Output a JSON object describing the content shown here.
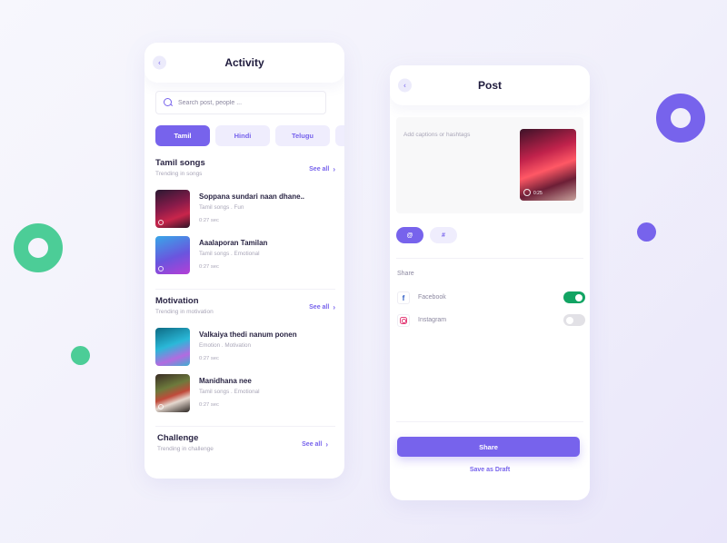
{
  "colors": {
    "accent": "#7763ec",
    "green": "#4ccd97",
    "toggle_on": "#12a463"
  },
  "activity": {
    "title": "Activity",
    "back_icon": "chevron-left-icon",
    "search": {
      "placeholder": "Search post, people ...",
      "value": ""
    },
    "tabs": [
      {
        "label": "Tamil",
        "active": true
      },
      {
        "label": "Hindi",
        "active": false
      },
      {
        "label": "Telugu",
        "active": false
      },
      {
        "label": "",
        "active": false
      }
    ],
    "sections": [
      {
        "title": "Tamil songs",
        "subtitle": "Trending in songs",
        "see_all": "See all",
        "items": [
          {
            "name": "Soppana sundari naan dhane..",
            "meta": "Tamil songs . Fun",
            "duration": "0:27 sec"
          },
          {
            "name": "Aaalaporan Tamilan",
            "meta": "Tamil songs . Emotional",
            "duration": "0:27 sec"
          }
        ]
      },
      {
        "title": "Motivation",
        "subtitle": "Trending in motivation",
        "see_all": "See all",
        "items": [
          {
            "name": "Valkaiya thedi nanum ponen",
            "meta": "Emotion . Motivation",
            "duration": "0:27 sec"
          },
          {
            "name": "Manidhana nee",
            "meta": "Tamil songs . Emotional",
            "duration": "0:27 sec"
          }
        ]
      },
      {
        "title": "Challenge",
        "subtitle": "Trending in challenge",
        "see_all": "See all",
        "items": []
      }
    ]
  },
  "post": {
    "title": "Post",
    "back_icon": "chevron-left-icon",
    "caption_placeholder": "Add captions or hashtags",
    "video_duration": "0:25",
    "tag_buttons": [
      {
        "label": "@",
        "active": true
      },
      {
        "label": "#",
        "active": false
      }
    ],
    "share_label": "Share",
    "social": [
      {
        "label": "Facebook",
        "icon": "facebook-icon",
        "enabled": true
      },
      {
        "label": "Instagram",
        "icon": "instagram-icon",
        "enabled": false
      }
    ],
    "share_button": "Share",
    "save_draft": "Save as Draft"
  }
}
